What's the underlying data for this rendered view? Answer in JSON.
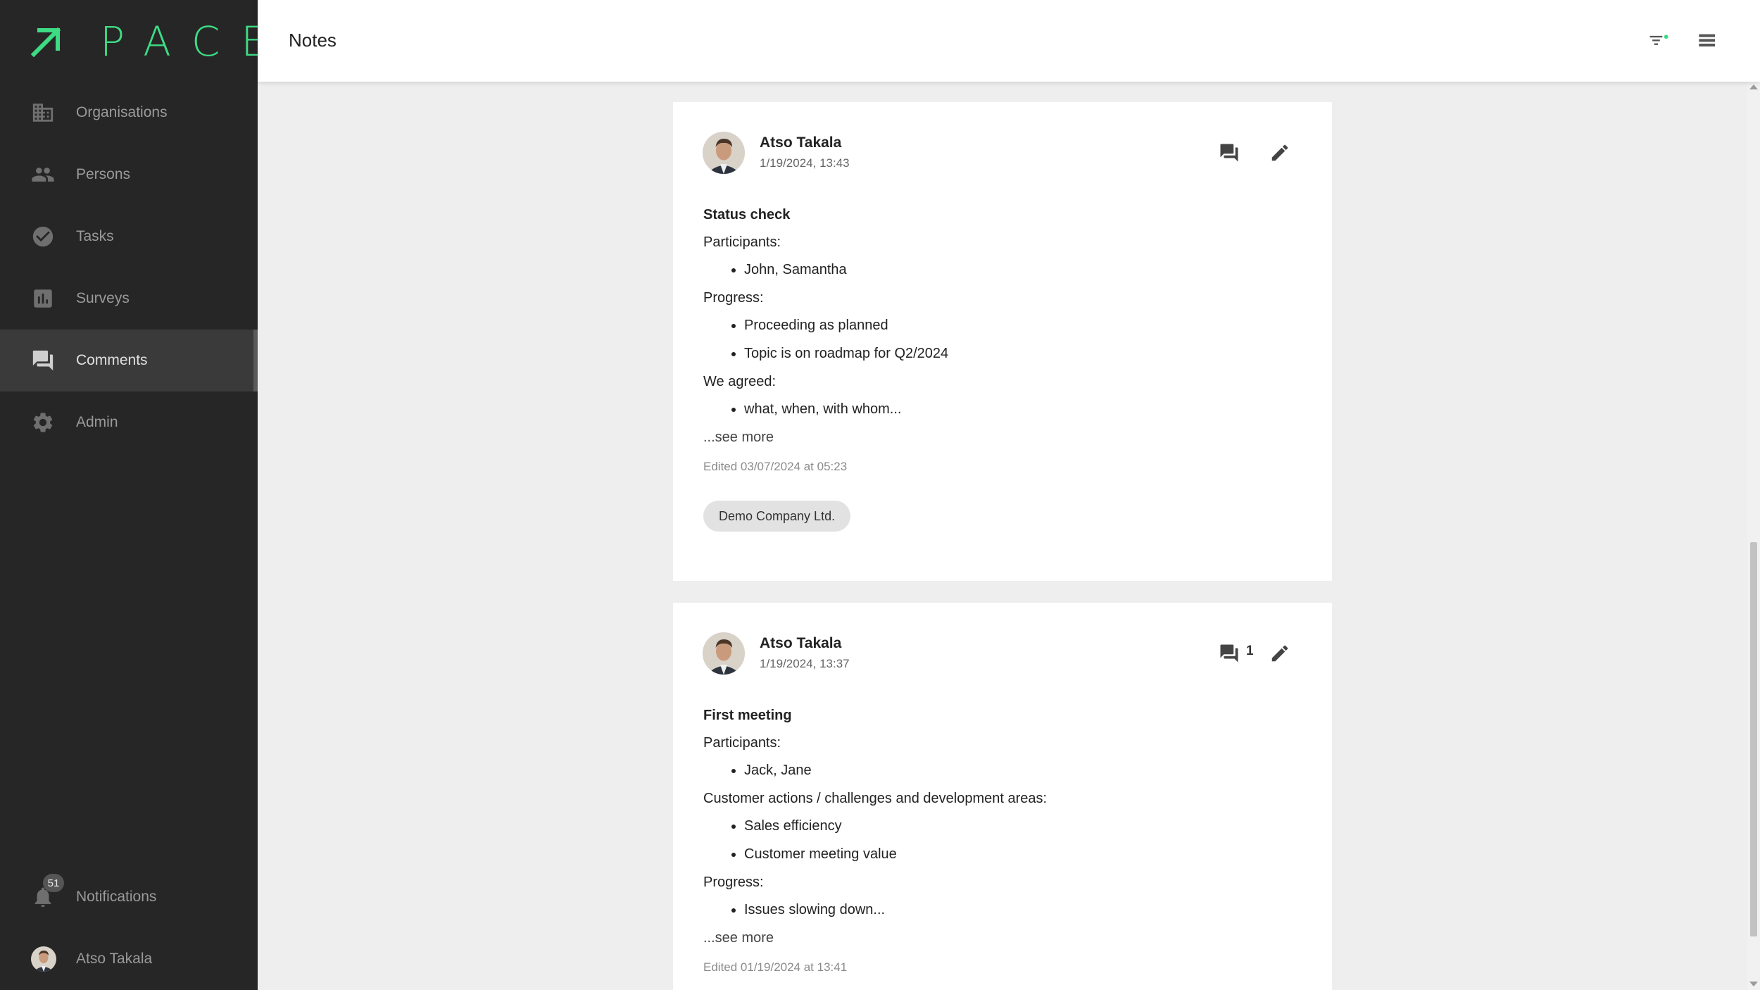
{
  "app": {
    "name": "PACE",
    "accent": "#3ddc84"
  },
  "sidebar": {
    "items": [
      {
        "label": "Organisations",
        "icon": "building-icon"
      },
      {
        "label": "Persons",
        "icon": "people-icon"
      },
      {
        "label": "Tasks",
        "icon": "check-circle-icon"
      },
      {
        "label": "Surveys",
        "icon": "bar-chart-icon"
      },
      {
        "label": "Comments",
        "icon": "forum-icon",
        "active": true
      },
      {
        "label": "Admin",
        "icon": "gear-icon"
      }
    ],
    "notifications": {
      "label": "Notifications",
      "count": "51"
    },
    "user": {
      "name": "Atso Takala"
    }
  },
  "header": {
    "title": "Notes"
  },
  "notes": [
    {
      "author": "Atso Takala",
      "date": "1/19/2024, 13:43",
      "title": "Status check",
      "comment_count": "",
      "sections": [
        {
          "heading": "Participants:",
          "items": [
            "John, Samantha"
          ]
        },
        {
          "heading": "Progress:",
          "items": [
            "Proceeding as planned",
            "Topic is on roadmap for Q2/2024"
          ]
        },
        {
          "heading": "We agreed:",
          "items": [
            "what, when, with whom..."
          ]
        }
      ],
      "see_more": "...see more",
      "edited": "Edited 03/07/2024 at 05:23",
      "tag": "Demo Company Ltd."
    },
    {
      "author": "Atso Takala",
      "date": "1/19/2024, 13:37",
      "title": "First meeting",
      "comment_count": "1",
      "sections": [
        {
          "heading": "Participants:",
          "items": [
            "Jack, Jane"
          ]
        },
        {
          "heading": "Customer actions / challenges and development areas:",
          "items": [
            "Sales efficiency",
            "Customer meeting value"
          ]
        },
        {
          "heading": "Progress:",
          "items": [
            "Issues slowing down..."
          ]
        }
      ],
      "see_more": "...see more",
      "edited": "Edited 01/19/2024 at 13:41"
    }
  ]
}
